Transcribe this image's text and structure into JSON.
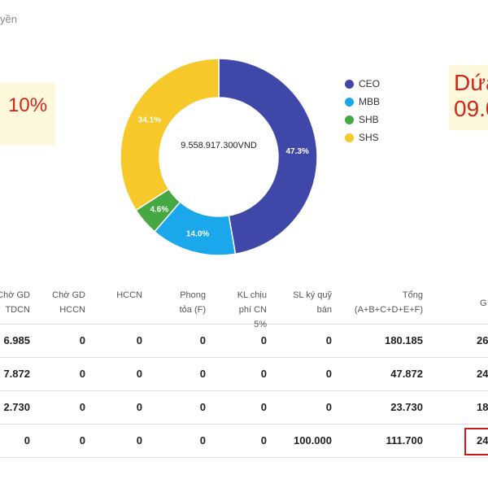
{
  "breadcrumb": "yền",
  "notes": {
    "left": "10%",
    "right_line1": "Dứa",
    "right_line2": "09.0"
  },
  "chart_data": {
    "type": "pie",
    "center_label": "9.558.917.300VND",
    "categories": [
      "CEO",
      "MBB",
      "SHB",
      "SHS"
    ],
    "values": [
      47.3,
      14.0,
      4.6,
      34.1
    ],
    "labels": [
      "47.3%",
      "14.0%",
      "4.6%",
      "34.1%"
    ],
    "colors": [
      "#3f48a8",
      "#1aa7ec",
      "#45a843",
      "#f6c82a"
    ],
    "legend_position": "right"
  },
  "table": {
    "headers": [
      "Chờ GD\nTDCN",
      "Chờ GD\nHCCN",
      "HCCN",
      "Phong\ntỏa (F)",
      "KL chịu\nphí CN\n5%",
      "SL ký quỹ\nbán",
      "Tổng\n(A+B+C+D+E+F)",
      "G"
    ],
    "rows": [
      [
        "6.985",
        "0",
        "0",
        "0",
        "0",
        "0",
        "180.185",
        "26"
      ],
      [
        "7.872",
        "0",
        "0",
        "0",
        "0",
        "0",
        "47.872",
        "24"
      ],
      [
        "2.730",
        "0",
        "0",
        "0",
        "0",
        "0",
        "23.730",
        "18"
      ],
      [
        "0",
        "0",
        "0",
        "0",
        "0",
        "100.000",
        "111.700",
        "24"
      ]
    ]
  }
}
